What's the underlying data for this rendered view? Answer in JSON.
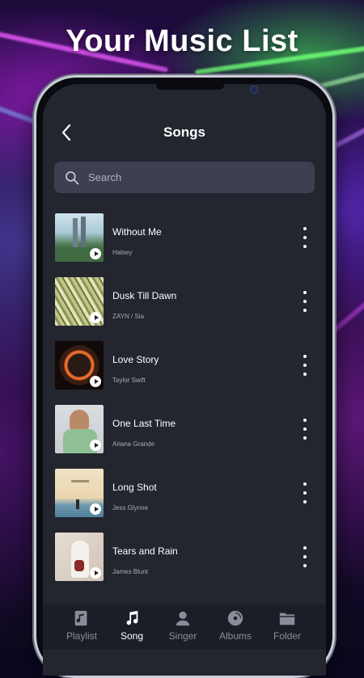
{
  "promo": {
    "title": "Your Music List"
  },
  "header": {
    "title": "Songs"
  },
  "search": {
    "placeholder": "Search"
  },
  "songs": [
    {
      "title": "Without Me",
      "artist": "Halsey"
    },
    {
      "title": "Dusk Till Dawn",
      "artist": "ZAYN / Sia"
    },
    {
      "title": "Love Story",
      "artist": "Taylor Swift"
    },
    {
      "title": "One Last Time",
      "artist": "Ariana Grande"
    },
    {
      "title": "Long Shot",
      "artist": "Jess Glynne"
    },
    {
      "title": "Tears and Rain",
      "artist": "James Blunt"
    }
  ],
  "tabs": [
    {
      "label": "Playlist",
      "icon": "playlist-icon"
    },
    {
      "label": "Song",
      "icon": "music-note-icon",
      "active": true
    },
    {
      "label": "Singer",
      "icon": "person-icon"
    },
    {
      "label": "Albums",
      "icon": "disc-icon"
    },
    {
      "label": "Folder",
      "icon": "folder-icon"
    }
  ],
  "colors": {
    "screen_bg": "#23252f",
    "search_bg": "#3d4050",
    "tabbar_bg": "#1c1e27",
    "inactive_tab": "#8a8d99"
  }
}
